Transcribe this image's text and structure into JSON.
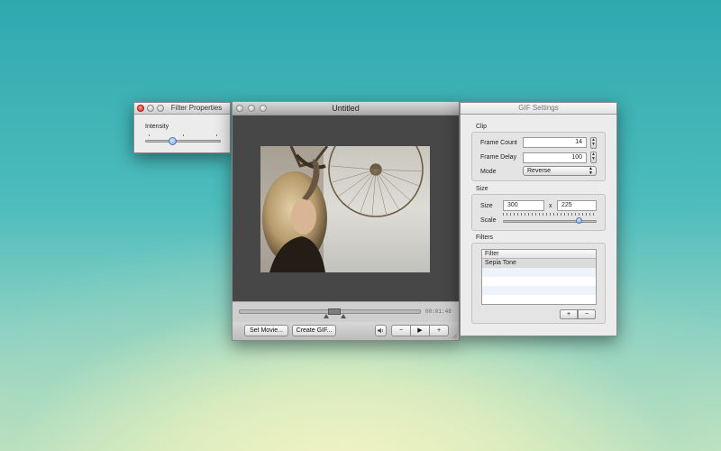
{
  "filter_properties": {
    "title": "Filter Properties",
    "intensity_label": "Intensity",
    "intensity_level": 0.35
  },
  "main_window": {
    "title": "Untitled",
    "timecode": "00:01:48",
    "set_movie_label": "Set Movie...",
    "create_gif_label": "Create GIF...",
    "minus_label": "−",
    "play_label": "▶",
    "plus_label": "+"
  },
  "gif_settings": {
    "title": "GIF Settings",
    "clip": {
      "group_title": "Clip",
      "frame_count_label": "Frame Count",
      "frame_count_value": "14",
      "frame_delay_label": "Frame Delay",
      "frame_delay_value": "100",
      "mode_label": "Mode",
      "mode_value": "Reverse"
    },
    "size": {
      "group_title": "Size",
      "size_label": "Size",
      "width_value": "300",
      "x_label": "x",
      "height_value": "225",
      "scale_label": "Scale",
      "scale_level": 0.83
    },
    "filters": {
      "group_title": "Filters",
      "column_header": "Filter",
      "rows": [
        "Sepia Tone"
      ],
      "add_label": "+",
      "remove_label": "−"
    }
  }
}
